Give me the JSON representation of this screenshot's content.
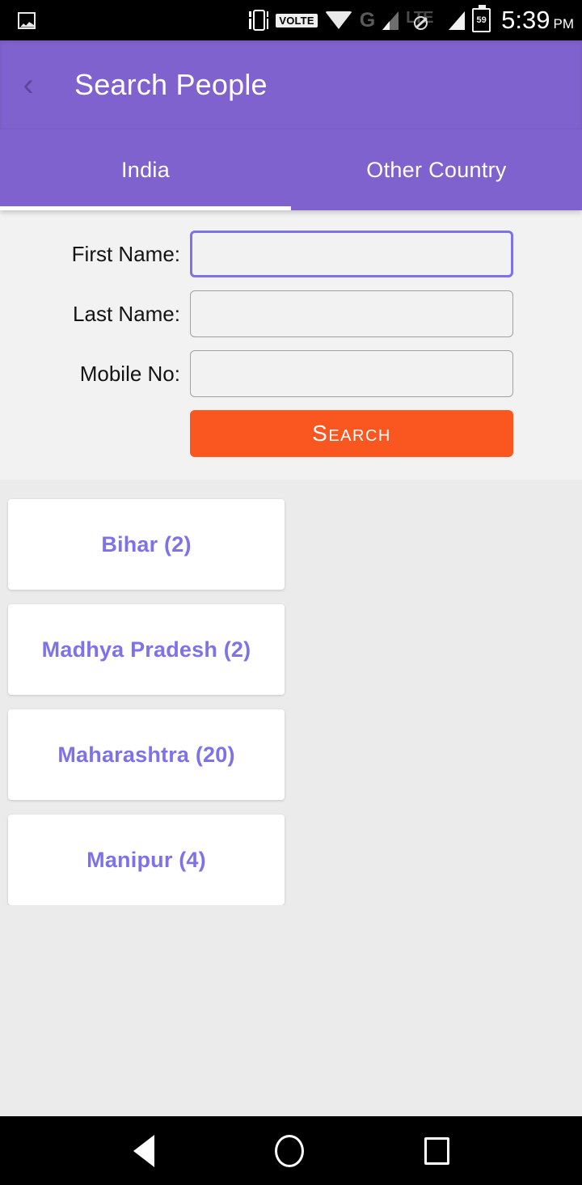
{
  "status_bar": {
    "notification_icon": "photo-icon",
    "icons": [
      "vibrate-icon",
      "volte-badge",
      "wifi-icon",
      "gprs-icon",
      "signal-icon",
      "lte-disabled-icon",
      "signal-icon-2",
      "battery-icon"
    ],
    "volte_label": "VOLTE",
    "network_label": "G",
    "lte_label": "LTE",
    "battery_percent": "59",
    "time": "5:39",
    "am_pm": "PM"
  },
  "app_bar": {
    "back_label": "‹",
    "title": "Search People"
  },
  "tabs": {
    "items": [
      {
        "label": "India",
        "active": true
      },
      {
        "label": "Other Country",
        "active": false
      }
    ]
  },
  "form": {
    "fields": [
      {
        "label": "First Name:",
        "value": "",
        "placeholder": "",
        "focused": true
      },
      {
        "label": "Last Name:",
        "value": "",
        "placeholder": "",
        "focused": false
      },
      {
        "label": "Mobile No:",
        "value": "",
        "placeholder": "",
        "focused": false
      }
    ],
    "submit_label": "Search"
  },
  "states": {
    "cards": [
      {
        "label": "Bihar (2)",
        "name": "Bihar",
        "count": 2
      },
      {
        "label": "Madhya Pradesh (2)",
        "name": "Madhya Pradesh",
        "count": 2
      },
      {
        "label": "Maharashtra (20)",
        "name": "Maharashtra",
        "count": 20
      },
      {
        "label": "Manipur (4)",
        "name": "Manipur",
        "count": 4
      }
    ]
  },
  "nav_bar": {
    "items": [
      "back-icon",
      "home-icon",
      "recents-icon"
    ]
  },
  "colors": {
    "primary_purple": "#7f62cd",
    "accent_purple": "#7d72ea",
    "orange": "#fa5620",
    "form_bg": "#f2f2f2",
    "grid_bg": "#ebebeb"
  }
}
